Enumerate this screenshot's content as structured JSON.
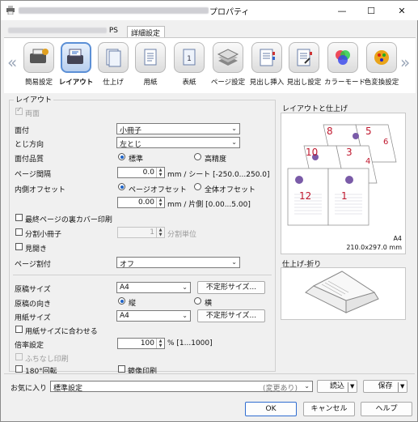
{
  "window": {
    "title_suffix": "プロパティ"
  },
  "tabs": [
    {
      "label": "PS"
    },
    {
      "label": "詳細設定"
    }
  ],
  "ribbon": {
    "items": [
      {
        "label": "簡易設定"
      },
      {
        "label": "レイアウト"
      },
      {
        "label": "仕上げ"
      },
      {
        "label": "用紙"
      },
      {
        "label": "表紙"
      },
      {
        "label": "ページ設定"
      },
      {
        "label": "見出し挿入"
      },
      {
        "label": "見出し設定"
      },
      {
        "label": "カラーモード"
      },
      {
        "label": "色変換設定"
      }
    ],
    "arrow_left": "«",
    "arrow_right": "»"
  },
  "layout": {
    "group_label": "レイアウト",
    "duplex_label": "両面",
    "mensuke": {
      "label": "面付",
      "value": "小冊子"
    },
    "binding": {
      "label": "とじ方向",
      "value": "左とじ"
    },
    "quality": {
      "label": "面付品質",
      "opt1": "標準",
      "opt2": "高精度"
    },
    "page_gap": {
      "label": "ページ間隔",
      "value": "0.0",
      "unit": "mm / シート [-250.0...250.0]"
    },
    "inner_offset": {
      "label": "内側オフセット",
      "opt1": "ページオフセット",
      "opt2": "全体オフセット",
      "value": "0.00",
      "unit": "mm / 片側 [0.00...5.00]"
    },
    "last_page_back": "最終ページの裏カバー印刷",
    "split_booklet": {
      "label": "分割小冊子",
      "value": "1",
      "unit": "分割単位"
    },
    "spread": "見開き",
    "page_split": {
      "label": "ページ割付",
      "value": "オフ"
    },
    "orig_size": {
      "label": "原稿サイズ",
      "value": "A4",
      "button": "不定形サイズ..."
    },
    "orientation": {
      "label": "原稿の向き",
      "opt1": "縦",
      "opt2": "横"
    },
    "paper_size": {
      "label": "用紙サイズ",
      "value": "A4",
      "button": "不定形サイズ..."
    },
    "fit_paper": "用紙サイズに合わせる",
    "zoom": {
      "label": "倍率設定",
      "value": "100",
      "unit": "% [1...1000]"
    },
    "borderless": "ふちなし印刷",
    "rotate180": "180°回転",
    "mirror": "鏡像印刷"
  },
  "preview": {
    "label": "レイアウトと仕上げ",
    "paper": "A4",
    "dimensions": "210.0x297.0 mm",
    "page_numbers": [
      "8",
      "5",
      "10",
      "3",
      "12",
      "1",
      "6",
      "4"
    ],
    "colors": {
      "page_number": "#c0182e"
    }
  },
  "finishing": {
    "label": "仕上げ-折り"
  },
  "favorites": {
    "label": "お気に入り",
    "value": "標準設定",
    "status": "(変更あり)",
    "load": "読込",
    "save": "保存"
  },
  "dialog_buttons": {
    "ok": "OK",
    "cancel": "キャンセル",
    "help": "ヘルプ"
  }
}
